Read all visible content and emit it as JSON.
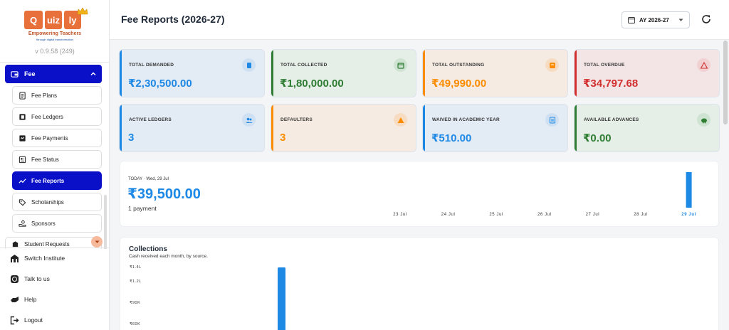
{
  "sidebar": {
    "logo_letters": [
      "Q",
      "uiz",
      "ly"
    ],
    "tagline": "Empowering Teachers",
    "subtagline": "through digital transformation",
    "version": "v 0.9.58 (249)",
    "fee_group": {
      "label": "Fee",
      "icon": "wallet-icon",
      "chevron": "chevron-up-icon"
    },
    "items": [
      {
        "label": "Fee Plans",
        "icon": "document-icon",
        "active": false
      },
      {
        "label": "Fee Ledgers",
        "icon": "ledger-icon",
        "active": false
      },
      {
        "label": "Fee Payments",
        "icon": "payment-icon",
        "active": false
      },
      {
        "label": "Fee Status",
        "icon": "status-icon",
        "active": false
      },
      {
        "label": "Fee Reports",
        "icon": "trend-icon",
        "active": true
      },
      {
        "label": "Scholarships",
        "icon": "tag-icon",
        "active": false
      },
      {
        "label": "Sponsors",
        "icon": "sponsor-icon",
        "active": false
      }
    ],
    "next_group": {
      "label": "Student Requests",
      "icon": "request-icon"
    },
    "bottom": [
      {
        "label": "Switch Institute",
        "icon": "institute-icon"
      },
      {
        "label": "Talk to us",
        "icon": "whatsapp-icon"
      },
      {
        "label": "Help",
        "icon": "help-icon"
      },
      {
        "label": "Logout",
        "icon": "logout-icon"
      }
    ]
  },
  "header": {
    "title": "Fee Reports (2026-27)",
    "year_selector": "AY 2026-27",
    "refresh_icon": "refresh-icon"
  },
  "cards": [
    {
      "label": "TOTAL DEMANDED",
      "value": "₹2,30,500.00",
      "color": "#1e88e5",
      "bg": "#e3ecf5",
      "icon": "receipt-icon",
      "iconbg": "#cfe0f3"
    },
    {
      "label": "TOTAL COLLECTED",
      "value": "₹1,80,000.00",
      "color": "#2e7d32",
      "bg": "#e6eee8",
      "icon": "calendar-check-icon",
      "iconbg": "#cfe3d2"
    },
    {
      "label": "TOTAL OUTSTANDING",
      "value": "₹49,990.00",
      "color": "#fb8c00",
      "bg": "#f5ebe2",
      "icon": "outstanding-icon",
      "iconbg": "#f7dcc2"
    },
    {
      "label": "TOTAL OVERDUE",
      "value": "₹34,797.68",
      "color": "#d32f2f",
      "bg": "#f3e5e6",
      "icon": "warning-icon",
      "iconbg": "#f1d0d1"
    },
    {
      "label": "ACTIVE LEDGERS",
      "value": "3",
      "color": "#1e88e5",
      "bg": "#e3ecf5",
      "icon": "people-icon",
      "iconbg": "#cfe0f3"
    },
    {
      "label": "DEFAULTERS",
      "value": "3",
      "color": "#fb8c00",
      "bg": "#f5ebe2",
      "icon": "alert-icon",
      "iconbg": "#f7dcc2"
    },
    {
      "label": "WAIVED IN ACADEMIC YEAR",
      "value": "₹510.00",
      "color": "#1e88e5",
      "bg": "#e3ecf5",
      "icon": "waiver-icon",
      "iconbg": "#cfe0f3"
    },
    {
      "label": "AVAILABLE ADVANCES",
      "value": "₹0.00",
      "color": "#2e7d32",
      "bg": "#e6eee8",
      "icon": "piggy-bank-icon",
      "iconbg": "#cfe3d2"
    }
  ],
  "today": {
    "label": "TODAY · Wed, 29 Jul",
    "amount": "₹39,500.00",
    "count": "1 payment"
  },
  "collections": {
    "title": "Collections",
    "subtitle": "Cash received each month, by source.",
    "y_ticks": [
      "₹1.4L",
      "₹1.2L",
      "₹90K",
      "₹60K"
    ]
  },
  "chart_data": [
    {
      "type": "bar",
      "categories": [
        "23 Jul",
        "24 Jul",
        "25 Jul",
        "26 Jul",
        "27 Jul",
        "28 Jul",
        "29 Jul"
      ],
      "values": [
        0,
        0,
        0,
        0,
        0,
        0,
        39500
      ],
      "highlight": "29 Jul",
      "bar_color": "#1e88e5"
    },
    {
      "type": "bar",
      "title": "Collections",
      "subtitle": "Cash received each month, by source.",
      "yticks": [
        "₹1.4L",
        "₹1.2L",
        "₹90K",
        "₹60K"
      ],
      "values": [
        180000
      ],
      "bar_color": "#1e88e5"
    }
  ]
}
